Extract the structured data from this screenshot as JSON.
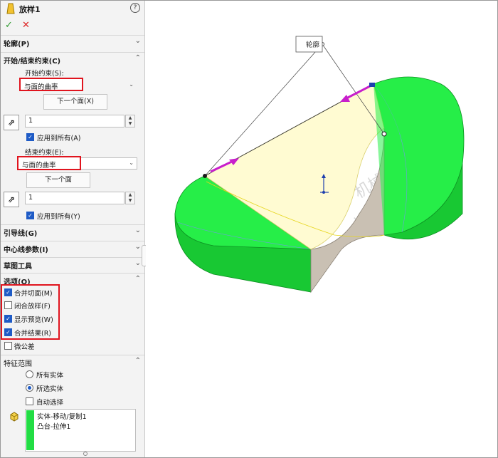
{
  "title": "放样1",
  "help_label": "?",
  "confirm": {
    "ok": "✓",
    "cancel": "✕"
  },
  "sections": {
    "profile": "轮廓(P)",
    "start_end": "开始/结束约束(C)",
    "guide": "引导线(G)",
    "centerline": "中心线参数(I)",
    "sketch_tools": "草图工具",
    "options": "选项(O)",
    "feature_scope": "特征范围"
  },
  "start": {
    "label": "开始约束(S):",
    "value": "与面的曲率",
    "next_face": "下一个面(X)",
    "number": "1",
    "apply_all": "应用到所有(A)"
  },
  "end": {
    "label": "结束约束(E):",
    "value": "与面的曲率",
    "next_face": "下一个面",
    "number": "1",
    "apply_all": "应用到所有(Y)"
  },
  "options": [
    {
      "label": "合并切面(M)",
      "checked": true
    },
    {
      "label": "闭合放样(F)",
      "checked": false
    },
    {
      "label": "显示预览(W)",
      "checked": true
    },
    {
      "label": "合并结果(R)",
      "checked": true
    },
    {
      "label": "微公差",
      "checked": false
    }
  ],
  "scope": {
    "all_bodies": "所有实体",
    "selected_bodies": "所选实体",
    "auto_select": "自动选择",
    "items": [
      "实体-移动/复制1",
      "凸台-拉伸1"
    ]
  },
  "viewport": {
    "callout": "轮廓",
    "watermark_1": "机械时代网",
    "watermark_2": "www.jxage.com"
  },
  "colors": {
    "body_green": "#22ee44",
    "loft_yellow": "#fffbd0",
    "arrow_magenta": "#c81ecc",
    "highlight_red": "#e0141e",
    "checkbox_blue": "#1e5bc6"
  }
}
